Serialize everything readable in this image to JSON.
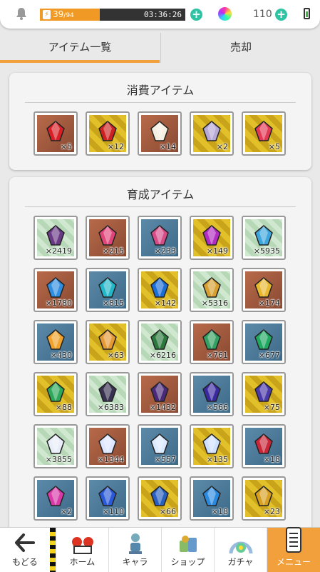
{
  "status": {
    "stamina_current": "39",
    "stamina_max": "/94",
    "stamina_fraction": 0.41,
    "timer": "03:36:26",
    "gem_count": "110"
  },
  "tabs": [
    {
      "label": "アイテム一覧",
      "active": true
    },
    {
      "label": "売却",
      "active": false
    }
  ],
  "consumables": {
    "title": "消費アイテム",
    "items": [
      {
        "count": "×5",
        "bg": "brown",
        "icon": "red-potion-icon"
      },
      {
        "count": "×12",
        "bg": "gold",
        "icon": "red-bottle-icon"
      },
      {
        "count": "×14",
        "bg": "brown",
        "icon": "mochi-icon"
      },
      {
        "count": "×2",
        "bg": "gold",
        "icon": "gift-box-icon"
      },
      {
        "count": "×5",
        "bg": "gold",
        "icon": "heart-box-icon"
      }
    ]
  },
  "growth": {
    "title": "育成アイテム",
    "items": [
      {
        "count": "×2419",
        "bg": "green",
        "icon": "purple-ore-icon"
      },
      {
        "count": "×215",
        "bg": "brown",
        "icon": "pink-crystal-icon"
      },
      {
        "count": "×233",
        "bg": "blue",
        "icon": "pink-crystal-large-icon"
      },
      {
        "count": "×149",
        "bg": "gold",
        "icon": "magenta-gem-icon"
      },
      {
        "count": "×5935",
        "bg": "green",
        "icon": "blue-ore-icon"
      },
      {
        "count": "×1780",
        "bg": "brown",
        "icon": "blue-gem-icon"
      },
      {
        "count": "×815",
        "bg": "blue",
        "icon": "teal-crystal-icon"
      },
      {
        "count": "×142",
        "bg": "gold",
        "icon": "blue-orb-icon"
      },
      {
        "count": "×5316",
        "bg": "green",
        "icon": "gold-ore-icon"
      },
      {
        "count": "×174",
        "bg": "brown",
        "icon": "gold-crystal-icon"
      },
      {
        "count": "×430",
        "bg": "blue",
        "icon": "amber-gem-icon"
      },
      {
        "count": "×63",
        "bg": "gold",
        "icon": "amber-winged-gem-icon"
      },
      {
        "count": "×6216",
        "bg": "green",
        "icon": "green-ore-icon"
      },
      {
        "count": "×761",
        "bg": "brown",
        "icon": "green-crystal-icon"
      },
      {
        "count": "×677",
        "bg": "blue",
        "icon": "emerald-icon"
      },
      {
        "count": "×88",
        "bg": "gold",
        "icon": "emerald-ring-icon"
      },
      {
        "count": "×6383",
        "bg": "green",
        "icon": "dark-ore-icon"
      },
      {
        "count": "×1432",
        "bg": "brown",
        "icon": "dark-purple-gem-icon"
      },
      {
        "count": "×566",
        "bg": "blue",
        "icon": "indigo-gem-icon"
      },
      {
        "count": "×75",
        "bg": "gold",
        "icon": "indigo-winged-gem-icon"
      },
      {
        "count": "×3855",
        "bg": "green",
        "icon": "white-ore-icon"
      },
      {
        "count": "×1344",
        "bg": "brown",
        "icon": "white-crystal-icon"
      },
      {
        "count": "×557",
        "bg": "blue",
        "icon": "diamond-icon"
      },
      {
        "count": "×135",
        "bg": "gold",
        "icon": "diamond-winged-icon"
      },
      {
        "count": "×18",
        "bg": "blue",
        "icon": "red-scroll-icon"
      },
      {
        "count": "×2",
        "bg": "blue",
        "icon": "pink-scroll-icon"
      },
      {
        "count": "×110",
        "bg": "blue",
        "icon": "blue-scroll-icon"
      },
      {
        "count": "×66",
        "bg": "gold",
        "icon": "blue-scroll-gold-icon"
      },
      {
        "count": "×18",
        "bg": "blue",
        "icon": "blue-scroll-large-icon"
      },
      {
        "count": "×23",
        "bg": "gold",
        "icon": "gold-scroll-icon"
      }
    ]
  },
  "nav": [
    {
      "label": "もどる",
      "icon": "back-arrow-icon",
      "active": false
    },
    {
      "label": "ホーム",
      "icon": "home-icon",
      "active": false
    },
    {
      "label": "キャラ",
      "icon": "character-icon",
      "active": false
    },
    {
      "label": "ショップ",
      "icon": "shop-icon",
      "active": false
    },
    {
      "label": "ガチャ",
      "icon": "gacha-icon",
      "active": false
    },
    {
      "label": "メニュー",
      "icon": "menu-scroll-icon",
      "active": true
    }
  ],
  "colors": {
    "accent": "#f2a03c",
    "plus": "#2fc3a4",
    "stamina": "#f09a25"
  }
}
